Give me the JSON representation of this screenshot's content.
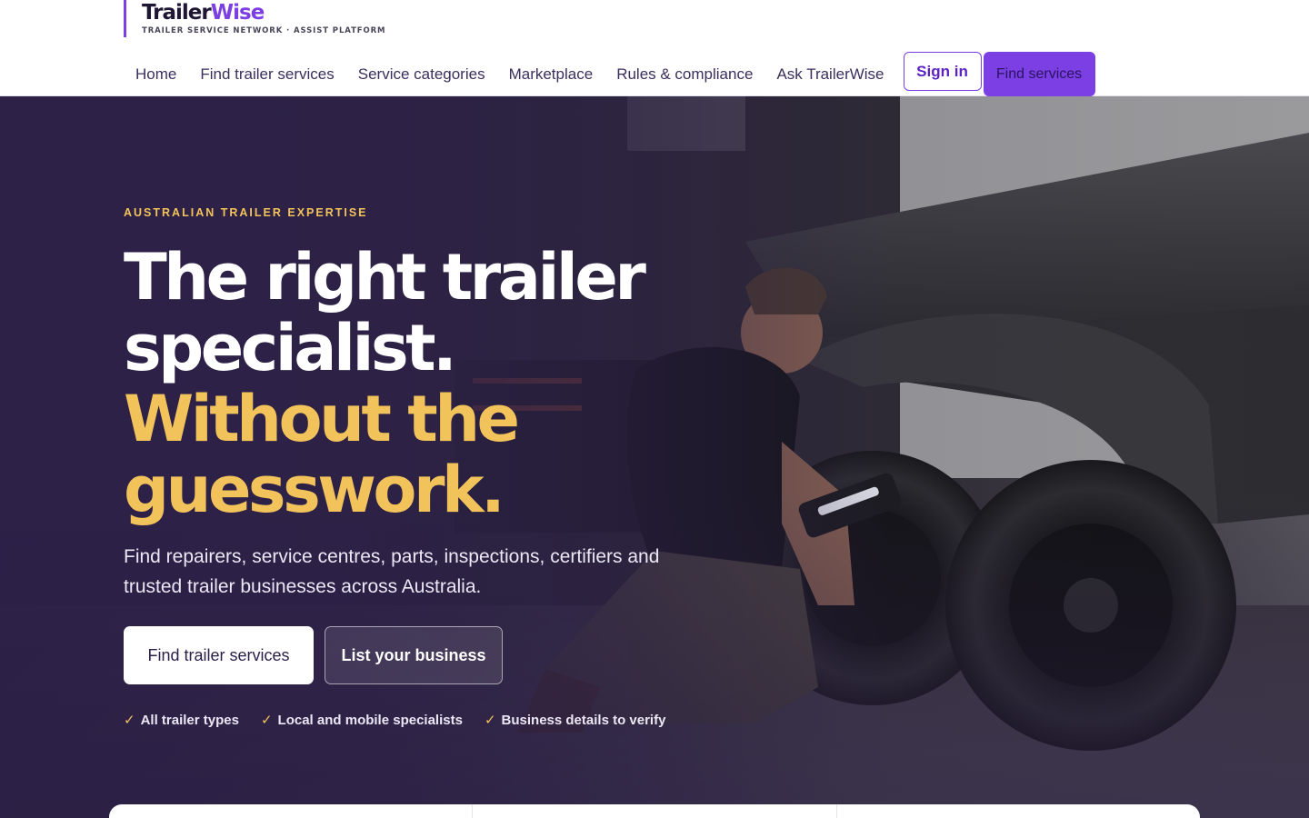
{
  "brand": {
    "name_part1": "Trailer",
    "name_part2": "Wise",
    "tagline": "TRAILER SERVICE NETWORK · ASSIST PLATFORM",
    "accent_color": "#7b3fe4",
    "gold_color": "#f3c35b"
  },
  "nav": {
    "items": [
      {
        "label": "Home"
      },
      {
        "label": "Find trailer services"
      },
      {
        "label": "Service categories"
      },
      {
        "label": "Marketplace"
      },
      {
        "label": "Rules & compliance"
      },
      {
        "label": "Ask TrailerWise"
      }
    ],
    "sign_in": "Sign in",
    "find_services": "Find services"
  },
  "hero": {
    "eyebrow": "AUSTRALIAN TRAILER EXPERTISE",
    "headline_white": "The right trailer specialist.",
    "headline_gold": "Without the guesswork.",
    "subtitle": "Find repairers, service centres, parts, inspections, certifiers and trusted trailer businesses across Australia.",
    "cta_primary": "Find trailer services",
    "cta_secondary": "List your business",
    "checks": [
      {
        "icon": "check-icon",
        "label": "All trailer types"
      },
      {
        "icon": "check-icon",
        "label": "Local and mobile specialists"
      },
      {
        "icon": "check-icon",
        "label": "Business details to verify"
      }
    ],
    "image": "mechanic-servicing-trailer-wheel"
  }
}
